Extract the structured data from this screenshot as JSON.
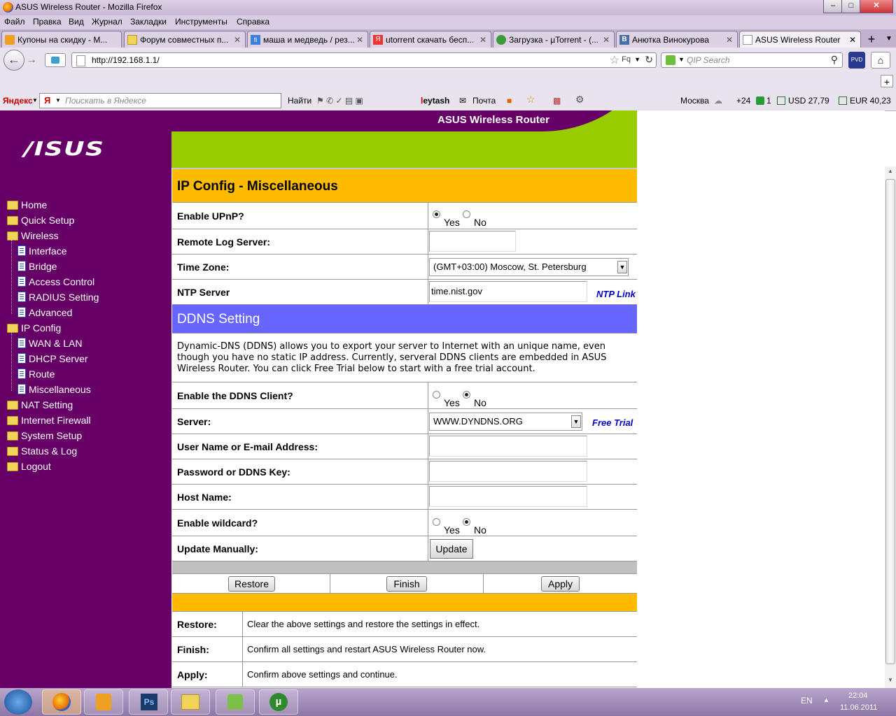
{
  "window": {
    "title": "ASUS Wireless Router - Mozilla Firefox"
  },
  "menu": [
    "Файл",
    "Правка",
    "Вид",
    "Журнал",
    "Закладки",
    "Инструменты",
    "Справка"
  ],
  "tabs": [
    {
      "label": "Купоны на скидку - М..."
    },
    {
      "label": "Форум совместных п..."
    },
    {
      "label": "маша и медведь / рез..."
    },
    {
      "label": "utorrent скачать бесп..."
    },
    {
      "label": "Загрузка - µTorrent - (..."
    },
    {
      "label": "Анютка Винокурова"
    },
    {
      "label": "ASUS Wireless Router"
    }
  ],
  "nav": {
    "url": "http://192.168.1.1/",
    "search_placeholder": "QIP Search"
  },
  "yandex": {
    "logo": "Яндекс",
    "search_placeholder": "Поискать в Яндексе",
    "find": "Найти",
    "user": "leytash",
    "mail": "Почта",
    "city": "Москва",
    "temp": "+24",
    "count": "1",
    "usd": "USD 27,79",
    "eur": "EUR 40,23"
  },
  "router": {
    "brand_title": "ASUS Wireless Router",
    "logo": "/ISUS",
    "sidebar": [
      {
        "label": "Home",
        "type": "folder",
        "level": 0
      },
      {
        "label": "Quick Setup",
        "type": "folder",
        "level": 0
      },
      {
        "label": "Wireless",
        "type": "folder",
        "level": 0
      },
      {
        "label": "Interface",
        "type": "doc",
        "level": 1
      },
      {
        "label": "Bridge",
        "type": "doc",
        "level": 1
      },
      {
        "label": "Access Control",
        "type": "doc",
        "level": 1
      },
      {
        "label": "RADIUS Setting",
        "type": "doc",
        "level": 1
      },
      {
        "label": "Advanced",
        "type": "doc",
        "level": 1
      },
      {
        "label": "IP Config",
        "type": "folder",
        "level": 0
      },
      {
        "label": "WAN & LAN",
        "type": "doc",
        "level": 1
      },
      {
        "label": "DHCP Server",
        "type": "doc",
        "level": 1
      },
      {
        "label": "Route",
        "type": "doc",
        "level": 1
      },
      {
        "label": "Miscellaneous",
        "type": "doc",
        "level": 1
      },
      {
        "label": "NAT Setting",
        "type": "folder",
        "level": 0
      },
      {
        "label": "Internet Firewall",
        "type": "folder",
        "level": 0
      },
      {
        "label": "System Setup",
        "type": "folder",
        "level": 0
      },
      {
        "label": "Status & Log",
        "type": "folder",
        "level": 0
      },
      {
        "label": "Logout",
        "type": "folder",
        "level": 0
      }
    ],
    "section_title": "IP Config - Miscellaneous",
    "upnp": {
      "label": "Enable UPnP?",
      "yes": "Yes",
      "no": "No",
      "value": "yes"
    },
    "remote_log": {
      "label": "Remote Log Server:",
      "value": ""
    },
    "time_zone": {
      "label": "Time Zone:",
      "value": "(GMT+03:00) Moscow, St. Petersburg"
    },
    "ntp": {
      "label": "NTP Server",
      "value": "time.nist.gov",
      "link": "NTP Link"
    },
    "ddns": {
      "title": "DDNS Setting",
      "description": "Dynamic-DNS (DDNS) allows you to export your server to Internet with an unique name, even though you have no static IP address. Currently, serveral DDNS clients are embedded in ASUS Wireless Router. You can click Free Trial below to start with a free trial account.",
      "enable": {
        "label": "Enable the DDNS Client?",
        "yes": "Yes",
        "no": "No",
        "value": "no"
      },
      "server": {
        "label": "Server:",
        "value": "WWW.DYNDNS.ORG",
        "link": "Free Trial"
      },
      "username": {
        "label": "User Name or E-mail Address:",
        "value": ""
      },
      "password": {
        "label": "Password or DDNS Key:",
        "value": ""
      },
      "hostname": {
        "label": "Host Name:",
        "value": ""
      },
      "wildcard": {
        "label": "Enable wildcard?",
        "yes": "Yes",
        "no": "No",
        "value": "no"
      },
      "update": {
        "label": "Update Manually:",
        "button": "Update"
      }
    },
    "buttons": {
      "restore": "Restore",
      "finish": "Finish",
      "apply": "Apply"
    },
    "help": [
      {
        "term": "Restore:",
        "desc": "Clear the above settings and restore the settings in effect."
      },
      {
        "term": "Finish:",
        "desc": "Confirm all settings and restart ASUS Wireless Router now."
      },
      {
        "term": "Apply:",
        "desc": "Confirm above settings and continue."
      }
    ]
  },
  "taskbar": {
    "lang": "EN",
    "time": "22:04",
    "date": "11.06.2011"
  }
}
